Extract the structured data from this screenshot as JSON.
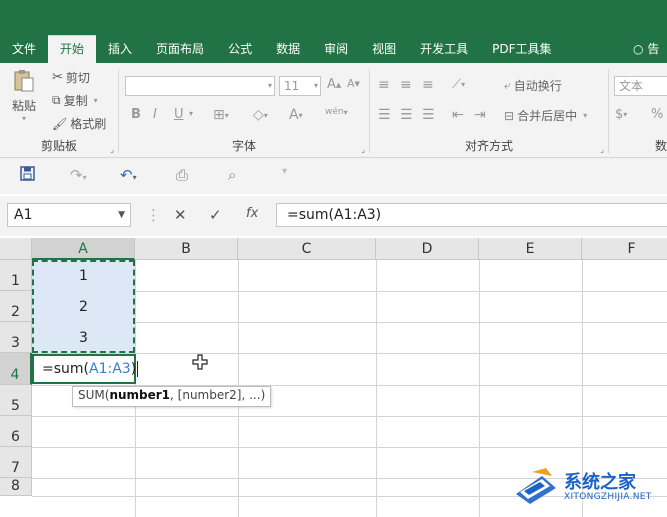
{
  "tabs": [
    {
      "label": "文件"
    },
    {
      "label": "开始"
    },
    {
      "label": "插入"
    },
    {
      "label": "页面布局"
    },
    {
      "label": "公式"
    },
    {
      "label": "数据"
    },
    {
      "label": "审阅"
    },
    {
      "label": "视图"
    },
    {
      "label": "开发工具"
    },
    {
      "label": "PDF工具集"
    }
  ],
  "help_label": "告",
  "ribbon": {
    "clipboard": {
      "paste_label": "粘贴",
      "cut_label": "剪切",
      "copy_label": "复制",
      "format_painter_label": "格式刷",
      "group_label": "剪贴板"
    },
    "font": {
      "font_name_value": "",
      "font_size_value": "11",
      "group_label": "字体",
      "bold": "B",
      "italic": "I",
      "underline": "U",
      "font_color_label": "A",
      "phonetic_label": "wén"
    },
    "alignment": {
      "wrap_text_label": "自动换行",
      "merge_label": "合并后居中",
      "group_label": "对齐方式"
    },
    "number": {
      "format_value": "文本",
      "percent_label": "%",
      "group_label": "数"
    }
  },
  "formula_bar": {
    "name_box": "A1",
    "cancel": "✕",
    "enter": "✓",
    "fx": "fx",
    "formula": "=sum(A1:A3)"
  },
  "grid": {
    "columns": [
      "A",
      "B",
      "C",
      "D",
      "E",
      "F"
    ],
    "rows": [
      "1",
      "2",
      "3",
      "4",
      "5",
      "6",
      "7",
      "8"
    ],
    "cells": {
      "A1": "1",
      "A2": "2",
      "A3": "3"
    },
    "editing_cell": {
      "prefix": "=sum(",
      "ref": "A1:A3",
      "suffix": ")"
    },
    "tooltip": {
      "fn": "SUM(",
      "arg1": "number1",
      "rest": ", [number2], ...)"
    }
  },
  "watermark": {
    "title": "系统之家",
    "subtitle": "XITONGZHIJIA.NET"
  },
  "colors": {
    "accent": "#217346",
    "selection_fill": "#dde8f6",
    "reference_blue": "#3a7dd1",
    "watermark_blue": "#1c63c6"
  }
}
